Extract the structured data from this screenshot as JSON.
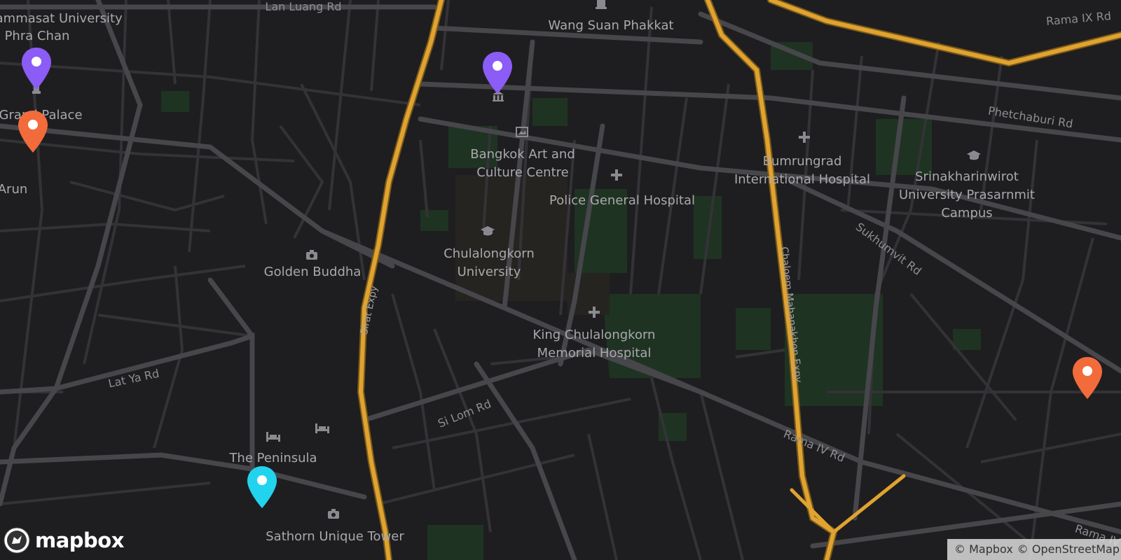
{
  "map": {
    "colors": {
      "background": "#1e1e20",
      "road": "#3a3a3e",
      "road_major": "#46464b",
      "highway": "#e0a330",
      "highway_casing": "#7a5a1a",
      "park": "#1f3322",
      "label": "#a9a9ad"
    },
    "labels": {
      "thammasat": "Thammasat University",
      "phra_chan": "Phra Chan",
      "lan_luang": "Lan Luang Rd",
      "wang_suan": "Wang Suan Phakkat",
      "rama_ix": "Rama IX Rd",
      "grand_palace": "Grand Palace",
      "phetchaburi": "Phetchaburi Rd",
      "arun": "Arun",
      "baccc_1": "Bangkok Art and",
      "baccc_2": "Culture Centre",
      "bumrungrad_1": "Bumrungrad",
      "bumrungrad_2": "International Hospital",
      "swu_1": "Srinakharinwirot",
      "swu_2": "University Prasarnmit",
      "swu_3": "Campus",
      "police_hospital": "Police General Hospital",
      "sukhumvit": "Sukhumvit Rd",
      "chula_1": "Chulalongkorn",
      "chula_2": "University",
      "golden_buddha": "Golden Buddha",
      "sirat": "Sirat Expy",
      "chaloem": "Chaloem Mahanakhon Expy",
      "kcmh_1": "King Chulalongkorn",
      "kcmh_2": "Memorial Hospital",
      "lat_ya": "Lat Ya Rd",
      "si_lom": "Si Lom Rd",
      "rama_iv": "Rama IV Rd",
      "rama_iv_2": "Rama IV",
      "peninsula": "The Peninsula",
      "sathorn": "Sathorn Unique Tower"
    },
    "markers": [
      {
        "id": "marker-grand-palace",
        "color": "#8b5cf6"
      },
      {
        "id": "marker-wang-suan",
        "color": "#8b5cf6"
      },
      {
        "id": "marker-wat-arun",
        "color": "#f26b3a"
      },
      {
        "id": "marker-sukhumvit",
        "color": "#f26b3a"
      },
      {
        "id": "marker-peninsula",
        "color": "#22d3ee"
      }
    ],
    "poi_icons": [
      "monument-icon",
      "museum-icon",
      "gallery-icon",
      "hospital-icon",
      "university-icon",
      "camera-icon",
      "hotel-icon"
    ]
  },
  "logo": {
    "text": "mapbox"
  },
  "attribution": {
    "mapbox": "© Mapbox",
    "osm": "© OpenStreetMap"
  }
}
